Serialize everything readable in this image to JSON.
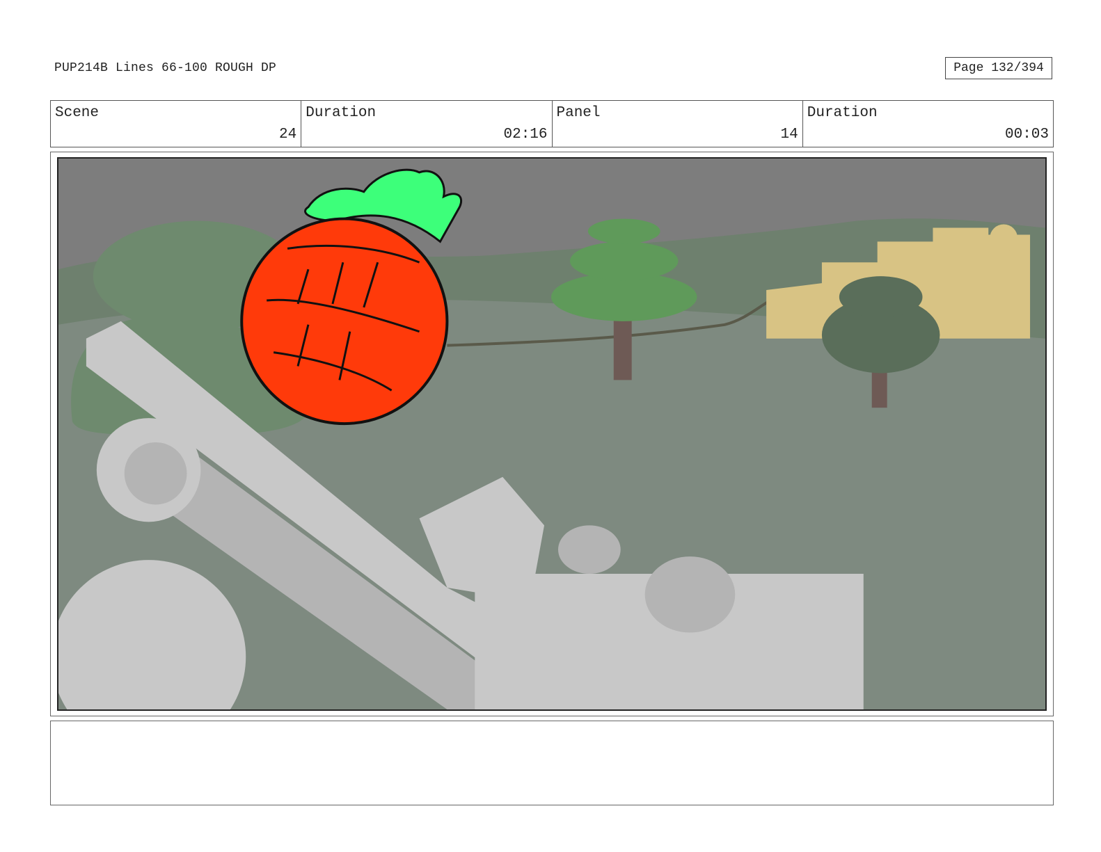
{
  "header": {
    "title": "PUP214B Lines 66-100 ROUGH DP",
    "page": "Page 132/394"
  },
  "info": {
    "scene_label": "Scene",
    "scene_value": "24",
    "scene_duration_label": "Duration",
    "scene_duration_value": "02:16",
    "panel_label": "Panel",
    "panel_value": "14",
    "panel_duration_label": "Duration",
    "panel_duration_value": "00:03"
  },
  "colors": {
    "sky": "#7d7d7d",
    "ground": "#7e8a80",
    "hill": "#6e8a6e",
    "tree_foliage": "#5f9a5a",
    "tree_trunk": "#6e5a55",
    "castle": "#d8c384",
    "machine": "#c8c8c8",
    "fruit": "#ff3a0a",
    "leaves": "#3dff7a",
    "outline": "#111111"
  },
  "notes": ""
}
